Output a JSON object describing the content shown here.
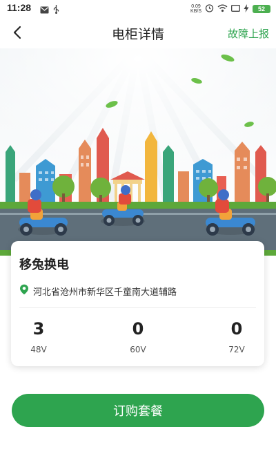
{
  "status_bar": {
    "time": "11:28",
    "net_speed_value": "0.09",
    "net_speed_unit": "KB/S",
    "battery": "52",
    "icons": [
      "gmail-icon",
      "usb-icon",
      "alarm-icon",
      "wifi-icon",
      "screen-icon",
      "charging-icon"
    ]
  },
  "nav": {
    "title": "电柜详情",
    "action_label": "故障上报",
    "back_icon": "chevron-left-icon"
  },
  "station": {
    "name": "移兔换电",
    "address": "河北省沧州市新华区千童南大道辅路",
    "stats": [
      {
        "count": "3",
        "label": "48V"
      },
      {
        "count": "0",
        "label": "60V"
      },
      {
        "count": "0",
        "label": "72V"
      }
    ]
  },
  "actions": {
    "buy_label": "订购套餐"
  },
  "colors": {
    "primary_green": "#2ea44f",
    "road": "#5f6f7a",
    "grass": "#6fb23c"
  }
}
